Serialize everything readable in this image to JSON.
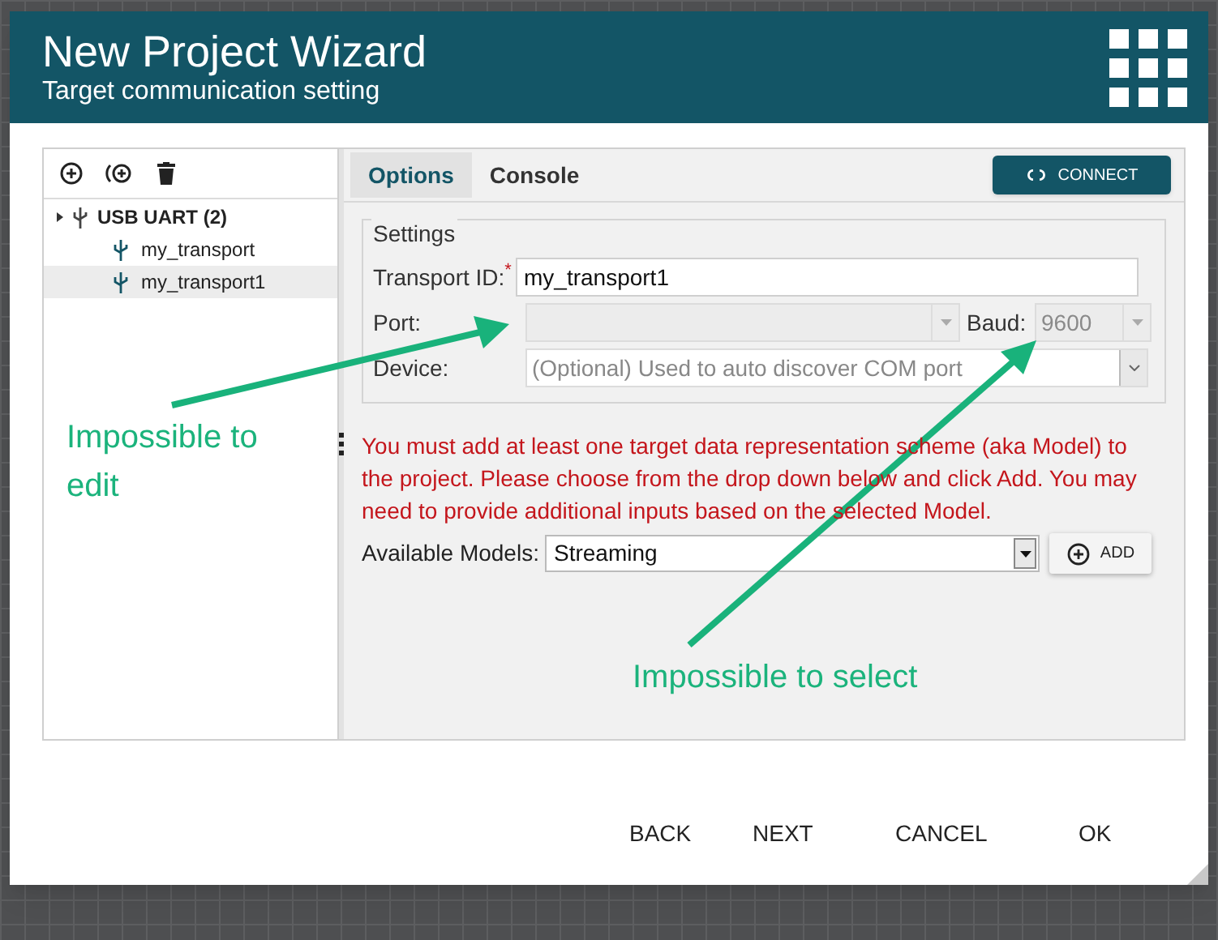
{
  "window": {
    "title": "New Project Wizard",
    "subtitle": "Target communication setting"
  },
  "tree": [
    {
      "label": "USB UART (2)",
      "selected": false,
      "children": [
        {
          "label": "my_transport",
          "selected": false
        },
        {
          "label": "my_transport1",
          "selected": true
        }
      ]
    }
  ],
  "tabs": [
    {
      "label": "Options",
      "selected": true
    },
    {
      "label": "Console",
      "selected": false
    }
  ],
  "connect_button": {
    "label": "CONNECT"
  },
  "settings": {
    "legend": "Settings",
    "transport_id": {
      "label": "Transport ID:",
      "required_mark": "*",
      "value": "my_transport1"
    },
    "port": {
      "label": "Port:",
      "disabled": true
    },
    "baud": {
      "label": "Baud:",
      "value": "9600",
      "disabled": true
    },
    "device": {
      "label": "Device:",
      "placeholder": "(Optional) Used to auto discover COM port"
    }
  },
  "message": "You must add at least one target data representation scheme (aka Model) to the project. Please choose from the drop down below and click Add. You may need to provide additional inputs based on the selected Model.",
  "models": {
    "label": "Available Models:",
    "value": "Streaming"
  },
  "add_button": {
    "label": "ADD"
  },
  "footer_buttons": [
    "BACK",
    "NEXT",
    "CANCEL",
    "OK"
  ],
  "annotations": [
    {
      "text": "Impossible to edit"
    },
    {
      "text": "Impossible to select"
    }
  ]
}
